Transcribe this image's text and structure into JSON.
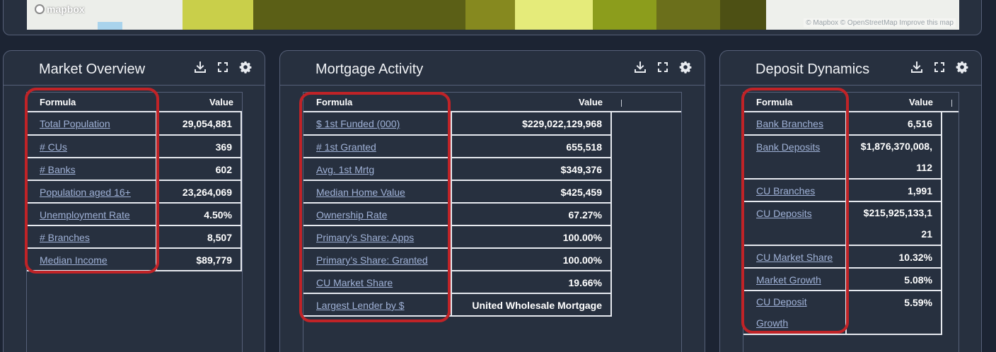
{
  "map": {
    "logo": "mapbox",
    "attribution": "© Mapbox © OpenStreetMap  Improve this map"
  },
  "colors": {
    "highlight": "#c02327",
    "link": "#9fb1d6",
    "panel_bg": "#27303f",
    "page_bg": "#1c2433"
  },
  "panels": {
    "market": {
      "title": "Market Overview",
      "header_formula": "Formula",
      "header_value": "Value",
      "rows": [
        {
          "formula": "Total Population",
          "value": "29,054,881"
        },
        {
          "formula": "# CUs",
          "value": "369"
        },
        {
          "formula": "# Banks",
          "value": "602"
        },
        {
          "formula": "Population aged 16+",
          "value": "23,264,069"
        },
        {
          "formula": "Unemployment Rate",
          "value": "4.50%"
        },
        {
          "formula": "# Branches",
          "value": "8,507"
        },
        {
          "formula": "Median Income",
          "value": "$89,779"
        }
      ]
    },
    "mortgage": {
      "title": "Mortgage Activity",
      "header_formula": "Formula",
      "header_value": "Value",
      "rows": [
        {
          "formula": "$ 1st Funded (000)",
          "value": "$229,022,129,968"
        },
        {
          "formula": "# 1st Granted",
          "value": "655,518"
        },
        {
          "formula": "Avg. 1st Mrtg",
          "value": "$349,376"
        },
        {
          "formula": "Median Home Value",
          "value": "$425,459"
        },
        {
          "formula": "Ownership Rate",
          "value": "67.27%"
        },
        {
          "formula": "Primary’s Share: Apps",
          "value": "100.00%"
        },
        {
          "formula": "Primary’s Share: Granted",
          "value": "100.00%"
        },
        {
          "formula": "CU Market Share",
          "value": "19.66%"
        },
        {
          "formula": "Largest Lender by $",
          "value": "United Wholesale Mortgage"
        }
      ]
    },
    "deposit": {
      "title": "Deposit Dynamics",
      "header_formula": "Formula",
      "header_value": "Value",
      "rows": [
        {
          "formula": "Bank Branches",
          "value": "6,516"
        },
        {
          "formula": "Bank Deposits",
          "value": "$1,876,370,008,",
          "value2": "112"
        },
        {
          "formula": "CU Branches",
          "value": "1,991"
        },
        {
          "formula": "CU Deposits",
          "value": "$215,925,133,1",
          "value2": "21"
        },
        {
          "formula": "CU Market Share",
          "value": "10.32%"
        },
        {
          "formula": "Market Growth",
          "value": "5.08%"
        },
        {
          "formula": "CU Deposit",
          "formula2": "Growth",
          "value": "5.59%"
        }
      ]
    }
  }
}
